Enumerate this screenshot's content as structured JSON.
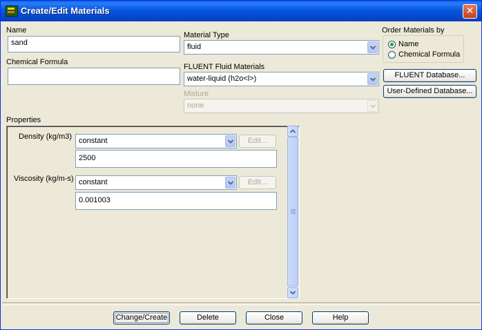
{
  "window": {
    "title": "Create/Edit Materials"
  },
  "name": {
    "label": "Name",
    "value": "sand"
  },
  "chemical_formula": {
    "label": "Chemical Formula",
    "value": ""
  },
  "material_type": {
    "label": "Material Type",
    "value": "fluid"
  },
  "fluent_materials": {
    "label": "FLUENT Fluid Materials",
    "value": "water-liquid (h2o<l>)"
  },
  "mixture": {
    "label": "Mixture",
    "value": "none"
  },
  "order_by": {
    "label": "Order Materials by",
    "options": [
      {
        "label": "Name",
        "selected": true
      },
      {
        "label": "Chemical Formula",
        "selected": false
      }
    ]
  },
  "buttons": {
    "fluent_db": "FLUENT Database...",
    "user_db": "User-Defined Database...",
    "change_create": "Change/Create",
    "delete": "Delete",
    "close": "Close",
    "help": "Help"
  },
  "properties": {
    "label": "Properties",
    "items": [
      {
        "label": "Density (kg/m3)",
        "method": "constant",
        "edit": "Edit...",
        "value": "2500"
      },
      {
        "label": "Viscosity (kg/m-s)",
        "method": "constant",
        "edit": "Edit...",
        "value": "0.001003"
      }
    ]
  }
}
